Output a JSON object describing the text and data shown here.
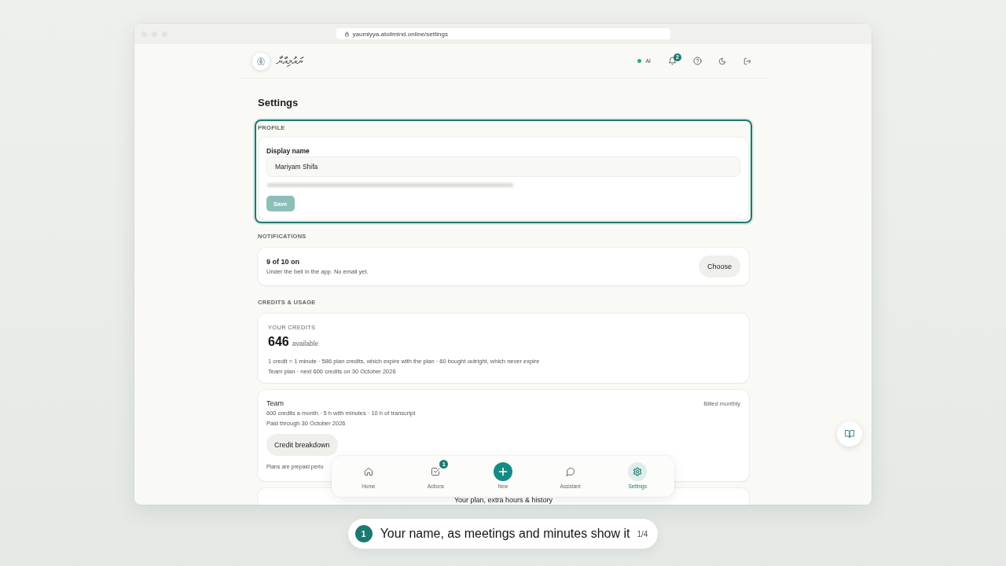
{
  "browser": {
    "url": "yaumiyya.atollmind.online/settings"
  },
  "header": {
    "app_name": "ޔައުމިއްޔާ",
    "ai_status": {
      "label": "AI",
      "online": true
    },
    "notifications_badge": "2"
  },
  "page_title": "Settings",
  "profile": {
    "section_label": "PROFILE",
    "highlighted": true,
    "field_label": "Display name",
    "value": "Mariyam Shifa",
    "save_button": {
      "label": "Save",
      "disabled": true
    }
  },
  "notifications": {
    "section_label": "NOTIFICATIONS",
    "summary": "9 of 10 on",
    "note": "Under the bell in the app. No email yet.",
    "button": "Choose"
  },
  "credits": {
    "section_label": "CREDITS & USAGE",
    "caption": "YOUR CREDITS",
    "amount": "646",
    "unit": "available",
    "lines": [
      "1 credit = 1 minute · 586 plan credits, which expire with the plan · 60 bought outright, which never expire",
      "Team plan · next 600 credits on 30 October 2026"
    ]
  },
  "plan": {
    "name": "Team",
    "billing": "Billed monthly",
    "lines": [
      "600 credits a month · 5 h with minutes · 10 h of transcript",
      "Paid through 30 October 2026"
    ],
    "button": "Credit breakdown",
    "note": "Plans are prepaid perio"
  },
  "next_card": {
    "title": "Your plan, extra hours & history"
  },
  "bottom_nav": [
    {
      "label": "Home",
      "kind": "home",
      "selected": false
    },
    {
      "label": "Actions",
      "kind": "tasks",
      "badge": "1",
      "selected": false
    },
    {
      "label": "New",
      "kind": "create",
      "selected": false
    },
    {
      "label": "Assistant",
      "kind": "chat",
      "selected": false
    },
    {
      "label": "Settings",
      "kind": "settings",
      "selected": true
    }
  ],
  "tour": {
    "step": "1",
    "text": "Your name, as meetings and minutes show it",
    "progress": "1/4"
  }
}
